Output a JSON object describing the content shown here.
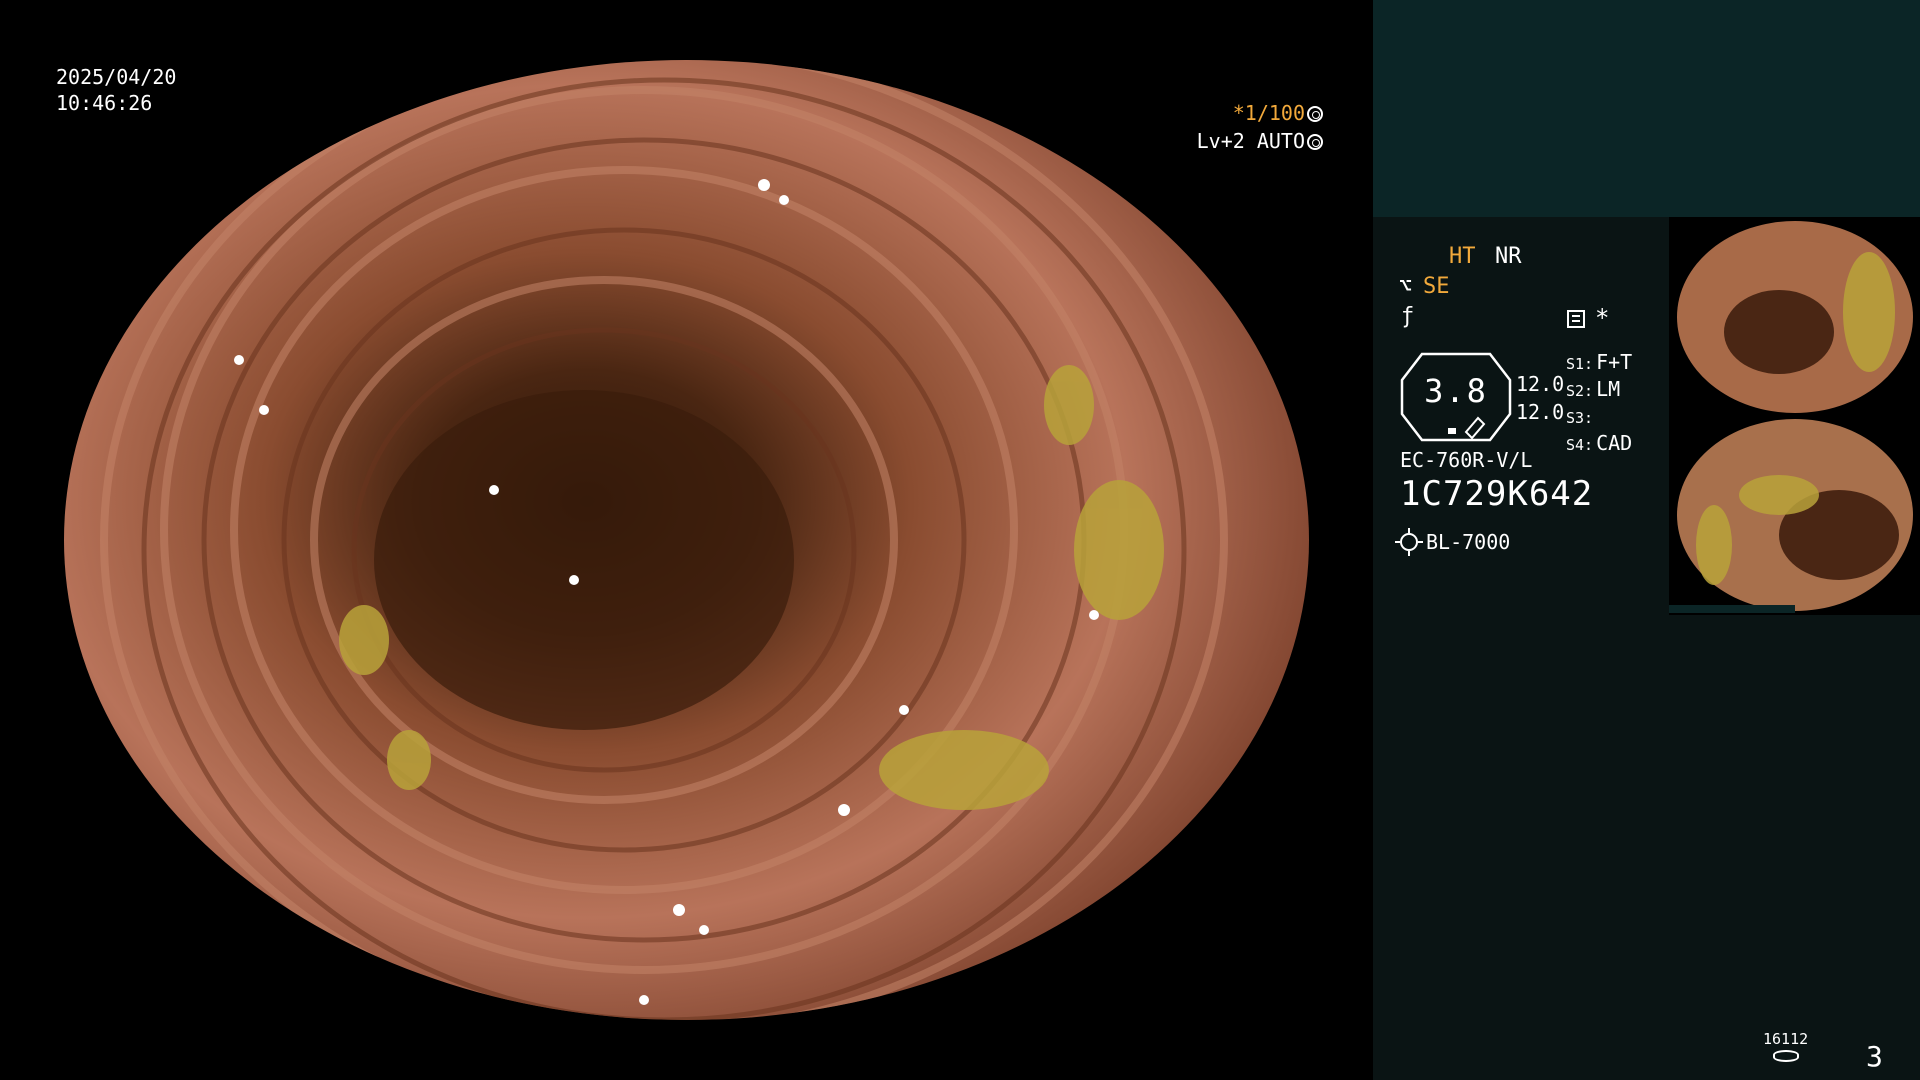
{
  "datetime": {
    "date": "2025/04/20",
    "time": "10:46:26"
  },
  "shutter": {
    "speed": "*1/100",
    "level": "Lv+2",
    "mode": "AUTO"
  },
  "status": {
    "ht": "HT",
    "nr": "NR",
    "se": "SE",
    "se_icon": "scope-angle-icon",
    "f_icon": "freeze-icon",
    "config_icon": "settings-list-icon",
    "star": "*"
  },
  "gauge": {
    "value": "3.8",
    "val1": "12.0",
    "val2": "12.0"
  },
  "slots": [
    {
      "key": "S1:",
      "val": "F+T"
    },
    {
      "key": "S2:",
      "val": "LM"
    },
    {
      "key": "S3:",
      "val": ""
    },
    {
      "key": "S4:",
      "val": "CAD"
    }
  ],
  "scope": {
    "model": "EC-760R-V/L",
    "serial": "1C729K642",
    "light_source": "BL-7000"
  },
  "counter": {
    "value": "16112",
    "page": "3"
  },
  "colors": {
    "accent": "#f2a93b",
    "panel_bg": "#0a1414",
    "panel_top_bg": "#0b2526"
  }
}
